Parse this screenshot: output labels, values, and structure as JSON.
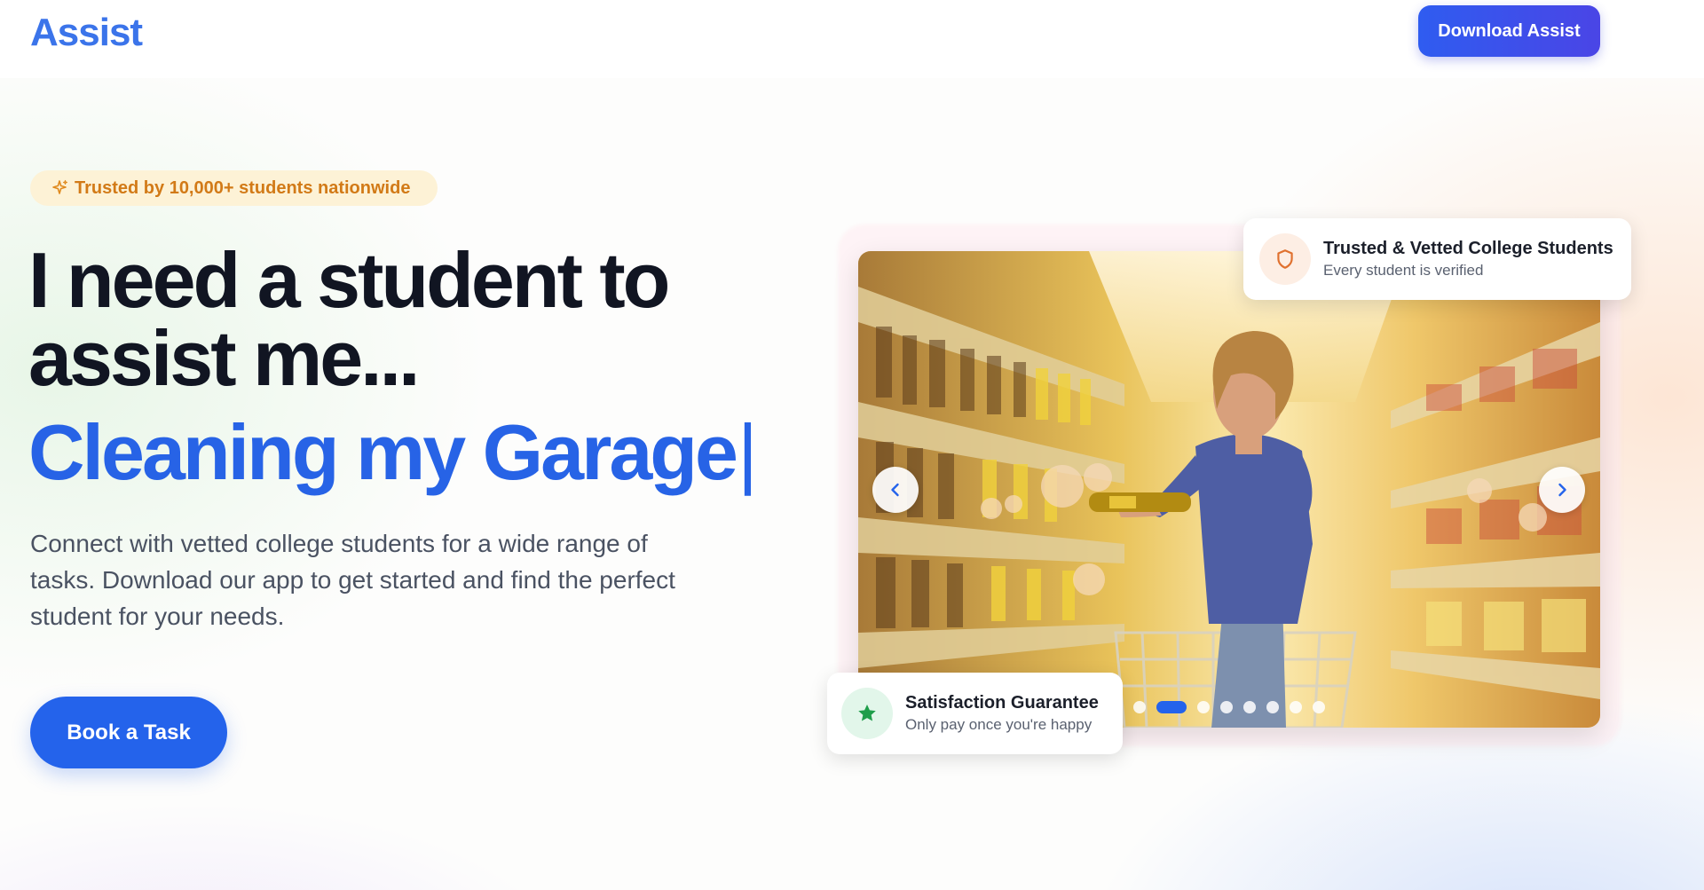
{
  "header": {
    "logo": "Assist",
    "download_label": "Download Assist"
  },
  "hero": {
    "badge": "Trusted by 10,000+ students nationwide",
    "headline_line1": "I need a student to",
    "headline_line2": "assist me...",
    "typed_text": "Cleaning my Garage",
    "typed_cursor": "|",
    "subtext": "Connect with vetted college students for a wide range of tasks. Download our app to get started and find the perfect student for your needs.",
    "cta_label": "Book a Task"
  },
  "carousel": {
    "image_subject": "student-shopping-grocery-aisle",
    "slide_count": 9,
    "active_slide_index": 2
  },
  "cards": {
    "trusted_title": "Trusted & Vetted College Students",
    "trusted_sub": "Every student is verified",
    "satisfaction_title": "Satisfaction Guarantee",
    "satisfaction_sub": "Only pay once you're happy"
  },
  "colors": {
    "brand_blue": "#2463eb",
    "logo_blue": "#3b74ea",
    "badge_bg": "#fdf2d6",
    "badge_text": "#d27a17",
    "shield_orange": "#e0712f",
    "star_green": "#1f9e4a"
  }
}
